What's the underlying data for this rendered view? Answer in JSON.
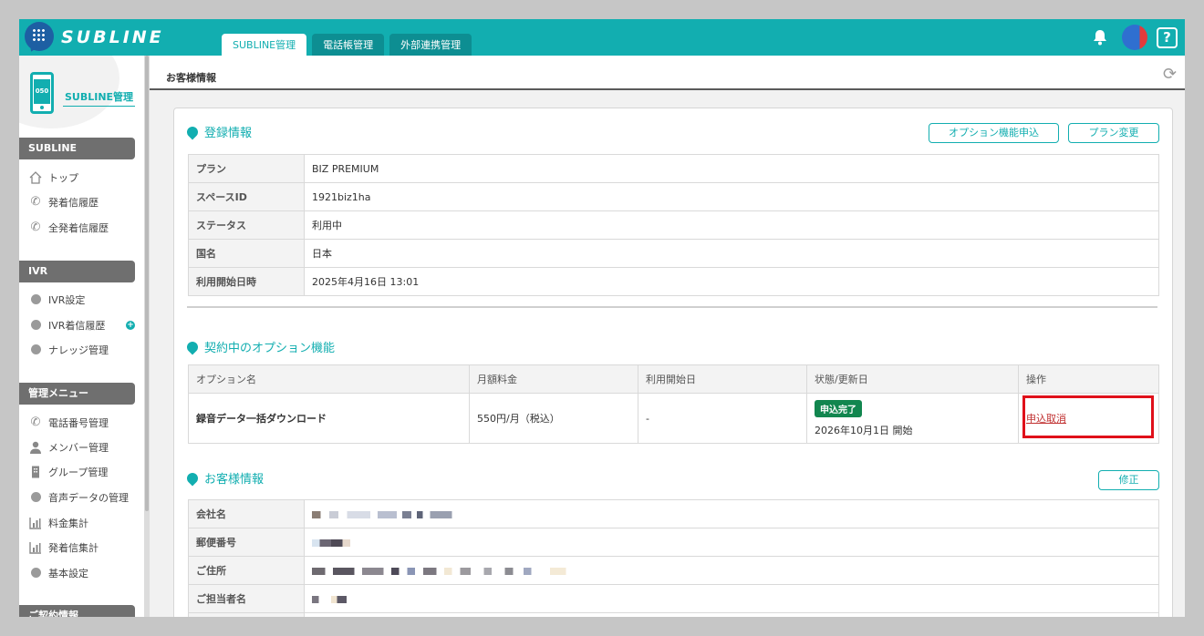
{
  "header": {
    "logo_text": "SUBLINE",
    "tabs": [
      {
        "label": "SUBLINE管理",
        "active": true
      },
      {
        "label": "電話帳管理",
        "active": false
      },
      {
        "label": "外部連携管理",
        "active": false
      }
    ],
    "help_label": "?"
  },
  "sidebar": {
    "brand_label": "SUBLINE管理",
    "phone_label": "050",
    "sections": [
      {
        "title": "SUBLINE",
        "items": [
          {
            "label": "トップ",
            "icon": "home-icon"
          },
          {
            "label": "発着信履歴",
            "icon": "phone-call-icon"
          },
          {
            "label": "全発着信履歴",
            "icon": "phone-call-icon"
          }
        ]
      },
      {
        "title": "IVR",
        "items": [
          {
            "label": "IVR設定",
            "icon": "bullet-icon"
          },
          {
            "label": "IVR着信履歴",
            "icon": "bullet-icon"
          },
          {
            "label": "ナレッジ管理",
            "icon": "bullet-icon"
          }
        ]
      },
      {
        "title": "管理メニュー",
        "items": [
          {
            "label": "電話番号管理",
            "icon": "phone-icon"
          },
          {
            "label": "メンバー管理",
            "icon": "user-icon"
          },
          {
            "label": "グループ管理",
            "icon": "building-icon"
          },
          {
            "label": "音声データの管理",
            "icon": "bullet-icon"
          },
          {
            "label": "料金集計",
            "icon": "bar-chart-icon"
          },
          {
            "label": "発着信集計",
            "icon": "bar-chart-icon"
          },
          {
            "label": "基本設定",
            "icon": "bullet-icon"
          }
        ]
      },
      {
        "title": "ご契約情報",
        "items": []
      }
    ]
  },
  "page": {
    "title": "お客様情報"
  },
  "registration": {
    "title": "登録情報",
    "option_button": "オプション機能申込",
    "plan_button": "プラン変更",
    "rows": [
      {
        "key": "プラン",
        "value": "BIZ PREMIUM"
      },
      {
        "key": "スペースID",
        "value": "1921biz1ha"
      },
      {
        "key": "ステータス",
        "value": "利用中"
      },
      {
        "key": "国名",
        "value": "日本"
      },
      {
        "key": "利用開始日時",
        "value": "2025年4月16日 13:01"
      }
    ]
  },
  "options": {
    "title": "契約中のオプション機能",
    "headers": [
      "オプション名",
      "月額料金",
      "利用開始日",
      "状態/更新日",
      "操作"
    ],
    "row": {
      "name": "録音データ一括ダウンロード",
      "fee": "550円/月（税込）",
      "start": "-",
      "status_badge": "申込完了",
      "status_date": "2026年10月1日 開始",
      "action": "申込取消"
    }
  },
  "customer": {
    "title": "お客様情報",
    "edit_button": "修正",
    "rows": [
      {
        "key": "会社名"
      },
      {
        "key": "郵便番号"
      },
      {
        "key": "ご住所"
      },
      {
        "key": "ご担当者名"
      }
    ]
  }
}
